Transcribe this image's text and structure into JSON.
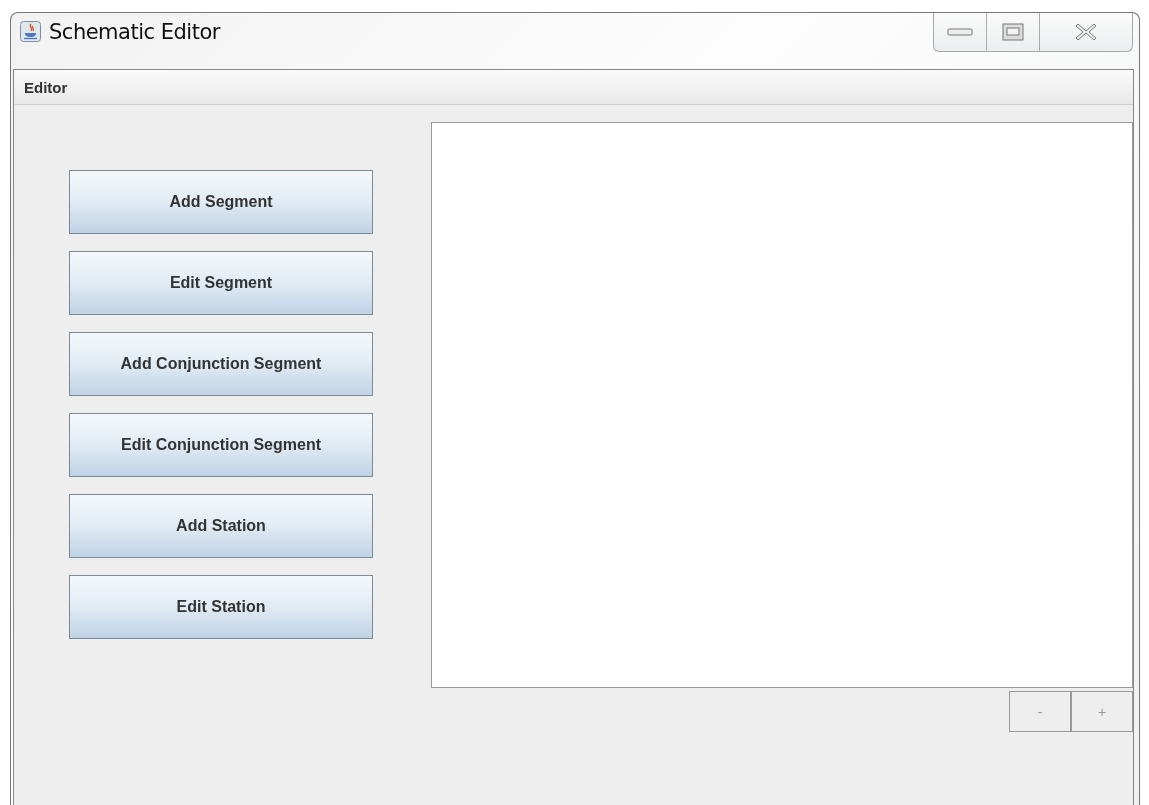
{
  "window": {
    "title": "Schematic Editor"
  },
  "menu_bar": [
    "Editor"
  ],
  "tool_buttons": [
    "Add Segment",
    "Edit Segment",
    "Add Conjunction Segment",
    "Edit Conjunction Segment",
    "Add Station",
    "Edit Station"
  ],
  "zoom_buttons": [
    "-",
    "+"
  ]
}
